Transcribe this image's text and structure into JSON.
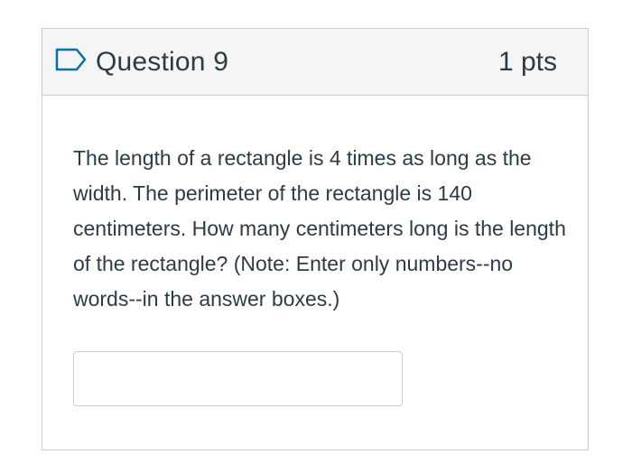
{
  "question": {
    "title": "Question 9",
    "points": "1 pts",
    "flag_icon": "flag-icon",
    "text": "The length of a rectangle is 4 times as long as the width. The perimeter of the rectangle is 140 centimeters. How many centimeters long is the length of the rectangle? (Note: Enter only numbers--no words--in the answer boxes.)",
    "answer_value": "",
    "answer_placeholder": ""
  },
  "colors": {
    "header_bg": "#f5f5f5",
    "border": "#c7cdd1",
    "text": "#2d3b45",
    "flag_accent": "#0770a3"
  }
}
